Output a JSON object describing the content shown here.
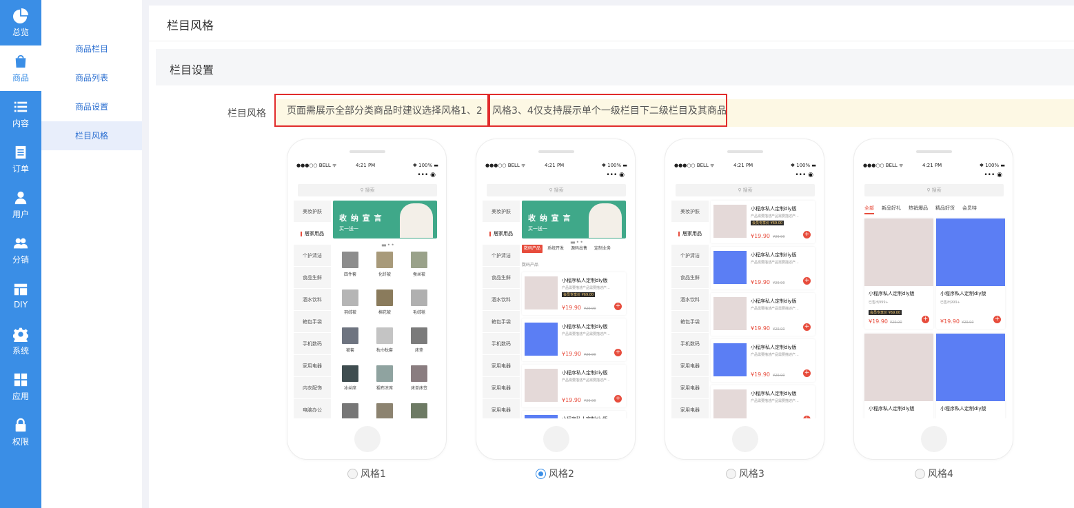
{
  "sidebar": {
    "items": [
      {
        "label": "总览",
        "icon": "pie-chart-icon"
      },
      {
        "label": "商品",
        "icon": "shopping-bag-icon"
      },
      {
        "label": "内容",
        "icon": "list-icon"
      },
      {
        "label": "订单",
        "icon": "document-icon"
      },
      {
        "label": "用户",
        "icon": "user-icon"
      },
      {
        "label": "分销",
        "icon": "users-icon"
      },
      {
        "label": "DIY",
        "icon": "layout-icon"
      },
      {
        "label": "系统",
        "icon": "gear-icon"
      },
      {
        "label": "应用",
        "icon": "grid-icon"
      },
      {
        "label": "权限",
        "icon": "lock-icon"
      }
    ],
    "active_index": 1
  },
  "subnav": {
    "items": [
      "商品栏目",
      "商品列表",
      "商品设置",
      "栏目风格"
    ],
    "active_index": 3
  },
  "page": {
    "title": "栏目风格",
    "section_title": "栏目设置",
    "field_label": "栏目风格",
    "notice_part1": "页面需展示全部分类商品时建议选择风格1、2",
    "notice_part2": "风格3、4仅支持展示单个一级栏目下二级栏目及其商品"
  },
  "phone": {
    "status_left": "●●●○○ BELL ᯤ",
    "status_time": "4:21 PM",
    "status_right": "✱ 100% ▬",
    "capsule": "••• ◉",
    "search_placeholder": "⚲ 搜索",
    "categories": [
      "美妆护肤",
      "居家用品",
      "个护清洁",
      "食品生鲜",
      "酒水饮料",
      "箱包手袋",
      "手机数码",
      "家用电器",
      "内衣配饰",
      "电脑办公"
    ],
    "categories_alt": [
      "美妆护肤",
      "居家用品",
      "个护清洁",
      "食品生鲜",
      "酒水饮料",
      "箱包手袋",
      "手机数码",
      "家用电器",
      "家用电器",
      "家用电器"
    ],
    "banner_title": "收 纳 宣 言",
    "banner_sub": "买一送一",
    "grid_items": [
      "四件套",
      "化纤被",
      "蚕丝被",
      "羽绒被",
      "棉花被",
      "毛绒毯",
      "被套",
      "枕巾枕套",
      "床垫",
      "冰丝席",
      "粗布凉席",
      "床单床笠",
      "",
      "",
      ""
    ],
    "style2_tabs": [
      "数码产品",
      "系统开发",
      "源码出售",
      "定制业务"
    ],
    "style2_caption": "数码产品",
    "product_title": "小程序私人定制diy版",
    "product_desc": "产品需要描述产品需要描述产...",
    "member_tag": "会员专享价 ¥69.00",
    "price": "¥19.90",
    "old_price": "¥29.90",
    "style4_tabs": [
      "全部",
      "新品好礼",
      "热销爆品",
      "精品好货",
      "会员特"
    ],
    "sold": "已售出999+",
    "add": "+"
  },
  "styles": [
    {
      "label": "风格1",
      "selected": false
    },
    {
      "label": "风格2",
      "selected": true
    },
    {
      "label": "风格3",
      "selected": false
    },
    {
      "label": "风格4",
      "selected": false
    }
  ],
  "colors": {
    "sidebar_bg": "#3a8ee6",
    "accent_red": "#e74c3c",
    "highlight_border": "#e12b2b",
    "notice_bg": "#fdf8e4"
  }
}
